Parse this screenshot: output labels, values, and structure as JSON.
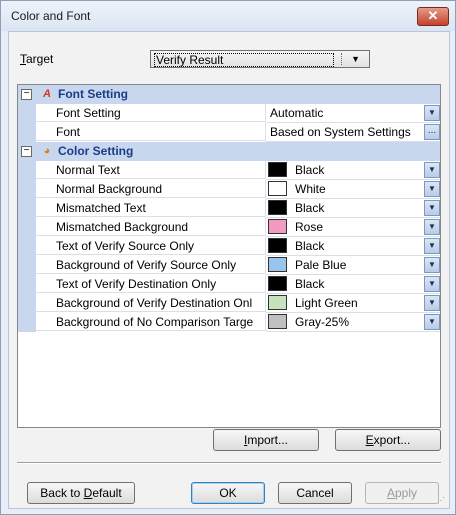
{
  "window": {
    "title": "Color and Font"
  },
  "target": {
    "label_u": "T",
    "label_rest": "arget",
    "value": "Verify Result"
  },
  "categories": {
    "font": {
      "label": "Font Setting"
    },
    "color": {
      "label": "Color Setting"
    }
  },
  "font_props": [
    {
      "name": "Font Setting",
      "value": "Automatic"
    },
    {
      "name": "Font",
      "value": "Based on System Settings"
    }
  ],
  "color_props": [
    {
      "name": "Normal Text",
      "value": "Black",
      "color": "#000000"
    },
    {
      "name": "Normal Background",
      "value": "White",
      "color": "#ffffff"
    },
    {
      "name": "Mismatched Text",
      "value": "Black",
      "color": "#000000"
    },
    {
      "name": "Mismatched Background",
      "value": "Rose",
      "color": "#f29ac4"
    },
    {
      "name": "Text of Verify Source Only",
      "value": "Black",
      "color": "#000000"
    },
    {
      "name": "Background of Verify Source Only",
      "value": "Pale Blue",
      "color": "#99c4ec"
    },
    {
      "name": "Text of Verify Destination Only",
      "value": "Black",
      "color": "#000000"
    },
    {
      "name": "Background of Verify Destination Onl",
      "value": "Light Green",
      "color": "#c7e3bd"
    },
    {
      "name": "Background of No Comparison Targe",
      "value": "Gray-25%",
      "color": "#c0c0c0"
    }
  ],
  "buttons": {
    "import": {
      "u": "I",
      "rest": "mport..."
    },
    "export": {
      "u": "E",
      "rest": "xport..."
    },
    "back_default": {
      "pre": "Back to ",
      "u": "D",
      "rest": "efault"
    },
    "ok": "OK",
    "cancel": "Cancel",
    "apply": {
      "u": "A",
      "rest": "pply"
    }
  },
  "icons": {
    "close": "close-icon",
    "font_category": "font-setting-icon",
    "color_category": "color-palette-icon",
    "dropdown": "chevron-down-icon",
    "ellipsis": "ellipsis-icon"
  },
  "colors": {
    "category_bg": "#c9d7ee",
    "category_text": "#1a3d8a",
    "accent": "#3c7fb1"
  }
}
